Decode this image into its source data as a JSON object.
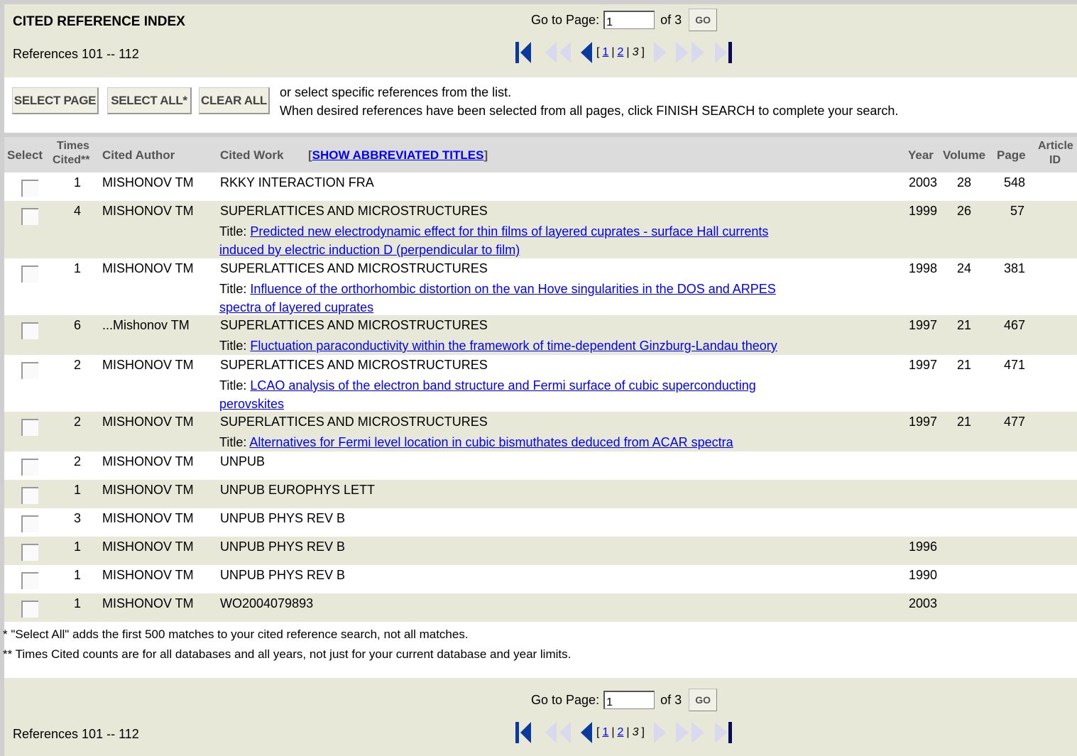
{
  "header": {
    "title": "CITED REFERENCE INDEX",
    "references_label": "References 101 -- 112",
    "goto_label": "Go to Page:",
    "page_value": "1",
    "of_label": "of 3",
    "go_button": "GO",
    "pages": {
      "open": "[",
      "p1": "1",
      "sep": "|",
      "p2": "2",
      "p3": "3",
      "close": "]"
    }
  },
  "selection": {
    "select_page": "SELECT PAGE",
    "select_all": "SELECT ALL*",
    "clear_all": "CLEAR ALL",
    "hint1": "or select specific references from the list.",
    "hint2": "When desired references have been selected from all pages, click FINISH SEARCH to complete your search."
  },
  "columns": {
    "select": "Select",
    "times_cited_1": "Times",
    "times_cited_2": "Cited**",
    "cited_author": "Cited Author",
    "cited_work": "Cited Work",
    "show_abbrev": "SHOW ABBREVIATED TITLES",
    "bracket_open": "[",
    "bracket_close": "]",
    "year": "Year",
    "volume": "Volume",
    "page": "Page",
    "article_id_1": "Article",
    "article_id_2": "ID"
  },
  "rows": [
    {
      "times": "1",
      "author": "MISHONOV TM",
      "work": "RKKY INTERACTION FRA",
      "year": "2003",
      "volume": "28",
      "page": "548",
      "title_label": "",
      "title": ""
    },
    {
      "times": "4",
      "author": "MISHONOV TM",
      "work": "SUPERLATTICES AND MICROSTRUCTURES",
      "year": "1999",
      "volume": "26",
      "page": "57",
      "title_label": "Title:",
      "title_l1": "Predicted new electrodynamic effect for thin films of layered cuprates - surface Hall currents",
      "title_l2": "induced by electric induction D (perpendicular to film)"
    },
    {
      "times": "1",
      "author": "MISHONOV TM",
      "work": "SUPERLATTICES AND MICROSTRUCTURES",
      "year": "1998",
      "volume": "24",
      "page": "381",
      "title_label": "Title:",
      "title_l1": "Influence of the orthorhombic distortion on the van Hove singularities in the DOS and ARPES",
      "title_l2": "spectra of layered cuprates"
    },
    {
      "times": "6",
      "author": "...Mishonov TM",
      "work": "SUPERLATTICES AND MICROSTRUCTURES",
      "year": "1997",
      "volume": "21",
      "page": "467",
      "title_label": "Title:",
      "title_l1": "Fluctuation paraconductivity within the framework of time-dependent Ginzburg-Landau theory",
      "title_l2": ""
    },
    {
      "times": "2",
      "author": "MISHONOV TM",
      "work": "SUPERLATTICES AND MICROSTRUCTURES",
      "year": "1997",
      "volume": "21",
      "page": "471",
      "title_label": "Title:",
      "title_l1": "LCAO analysis of the electron band structure and Fermi surface of cubic superconducting",
      "title_l2": "perovskites"
    },
    {
      "times": "2",
      "author": "MISHONOV TM",
      "work": "SUPERLATTICES AND MICROSTRUCTURES",
      "year": "1997",
      "volume": "21",
      "page": "477",
      "title_label": "Title:",
      "title_l1": "Alternatives for Fermi level location in cubic bismuthates deduced from ACAR spectra",
      "title_l2": ""
    },
    {
      "times": "2",
      "author": "MISHONOV TM",
      "work": "UNPUB",
      "year": "",
      "volume": "",
      "page": ""
    },
    {
      "times": "1",
      "author": "MISHONOV TM",
      "work": "UNPUB EUROPHYS LETT",
      "year": "",
      "volume": "",
      "page": ""
    },
    {
      "times": "3",
      "author": "MISHONOV TM",
      "work": "UNPUB PHYS REV B",
      "year": "",
      "volume": "",
      "page": ""
    },
    {
      "times": "1",
      "author": "MISHONOV TM",
      "work": "UNPUB PHYS REV B",
      "year": "1996",
      "volume": "",
      "page": ""
    },
    {
      "times": "1",
      "author": "MISHONOV TM",
      "work": "UNPUB PHYS REV B",
      "year": "1990",
      "volume": "",
      "page": ""
    },
    {
      "times": "1",
      "author": "MISHONOV TM",
      "work": "WO2004079893",
      "year": "2003",
      "volume": "",
      "page": ""
    }
  ],
  "footnotes": {
    "f1": "* \"Select All\" adds the first 500 matches to your cited reference search, not all matches.",
    "f2": "** Times Cited counts are for all databases and all years, not just for your current database and year limits."
  },
  "colors": {
    "panel_bg": "#e8e8d8",
    "header_bg": "#dcdcdc",
    "link": "#0000ff",
    "arrow_active": "#0a3a9c",
    "arrow_disabled": "#d8d8ee"
  },
  "icons": [
    "first-page-icon",
    "prev-ten-icon",
    "prev-page-icon",
    "next-page-icon",
    "next-ten-icon",
    "last-page-icon"
  ]
}
